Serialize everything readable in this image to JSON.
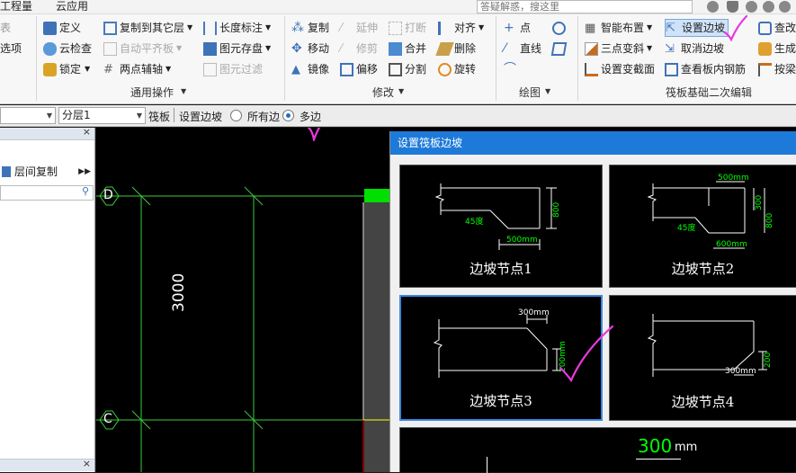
{
  "menu": {
    "tabs": [
      "工程量",
      "云应用"
    ]
  },
  "search": {
    "placeholder": "答疑解惑，搜这里"
  },
  "ribbon": {
    "left_stub": [
      "表",
      "选项"
    ],
    "general": {
      "items": [
        "定义",
        "云检查",
        "锁定",
        "复制到其它层",
        "自动平齐板",
        "两点辅轴",
        "长度标注",
        "图元存盘",
        "图元过滤"
      ],
      "label": "通用操作"
    },
    "modify": {
      "items": [
        "复制",
        "移动",
        "镜像",
        "延伸",
        "修剪",
        "偏移",
        "打断",
        "合并",
        "分割",
        "对齐",
        "删除",
        "旋转"
      ],
      "label": "修改"
    },
    "draw": {
      "items": [
        "点",
        "直线"
      ],
      "label": "绘图"
    },
    "raft": {
      "items": [
        "智能布置",
        "三点变斜",
        "设置变截面",
        "设置边坡",
        "取消边坡",
        "查看板内钢筋",
        "查改",
        "生成",
        "按梁"
      ],
      "label": "筏板基础二次编辑"
    }
  },
  "options": {
    "layer": "分层1",
    "type_label": "筏板",
    "op_label": "设置边坡",
    "radio_all": "所有边",
    "radio_multi": "多边"
  },
  "left_panel": {
    "copy_label": "层间复制"
  },
  "canvas": {
    "axis_d": "D",
    "axis_c": "C",
    "dimension": "3000"
  },
  "dialog": {
    "title": "设置筏板边坡",
    "cards": [
      {
        "label": "边坡节点1",
        "dims": [
          "800",
          "45度",
          "500mm"
        ]
      },
      {
        "label": "边坡节点2",
        "dims": [
          "500mm",
          "300",
          "800",
          "45度",
          "600mm"
        ]
      },
      {
        "label": "边坡节点3",
        "dims": [
          "300mm",
          "200mm"
        ]
      },
      {
        "label": "边坡节点4",
        "dims": [
          "200",
          "300mm"
        ]
      }
    ],
    "card5_dim": "300",
    "card5_unit": "mm"
  }
}
